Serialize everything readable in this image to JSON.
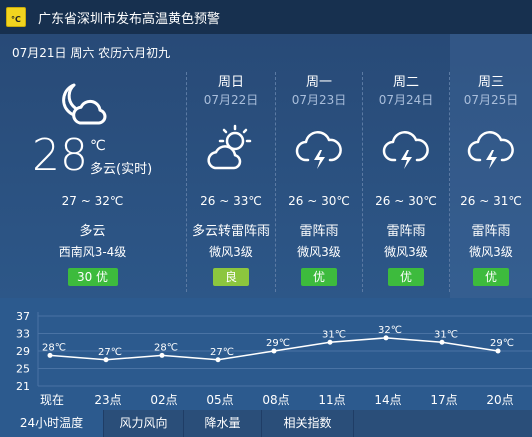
{
  "alert": {
    "icon": "high-temperature-alert-icon",
    "icon_text": "°C",
    "text": "广东省深圳市发布高温黄色预警"
  },
  "today": {
    "label": "07月21日 周六 农历六月初九",
    "icon": "night-partly-cloudy-icon",
    "temp_now": "28",
    "unit": "℃",
    "cond_now": "多云(实时)",
    "range": "27 ~ 32℃",
    "cond": "多云",
    "wind": "西南风3-4级",
    "aqi": "30 优",
    "aqi_color": "#3dbb3d"
  },
  "forecast": [
    {
      "dow": "周日",
      "date": "07月22日",
      "icon": "partly-cloudy-sun-icon",
      "range": "26 ~ 33℃",
      "cond": "多云转雷阵雨",
      "wind": "微风3级",
      "aqi": "良",
      "aqi_color": "#8cc63e"
    },
    {
      "dow": "周一",
      "date": "07月23日",
      "icon": "thunderstorm-icon",
      "range": "26 ~ 30℃",
      "cond": "雷阵雨",
      "wind": "微风3级",
      "aqi": "优",
      "aqi_color": "#3dbb3d"
    },
    {
      "dow": "周二",
      "date": "07月24日",
      "icon": "thunderstorm-icon",
      "range": "26 ~ 30℃",
      "cond": "雷阵雨",
      "wind": "微风3级",
      "aqi": "优",
      "aqi_color": "#3dbb3d"
    },
    {
      "dow": "周三",
      "date": "07月25日",
      "icon": "thunderstorm-icon",
      "range": "26 ~ 31℃",
      "cond": "雷阵雨",
      "wind": "微风3级",
      "aqi": "优",
      "aqi_color": "#3dbb3d"
    }
  ],
  "chart_data": {
    "type": "line",
    "categories": [
      "现在",
      "23点",
      "02点",
      "05点",
      "08点",
      "11点",
      "14点",
      "17点",
      "20点"
    ],
    "values": [
      28,
      27,
      28,
      27,
      29,
      31,
      32,
      31,
      29
    ],
    "point_labels": [
      "28℃",
      "27℃",
      "28℃",
      "27℃",
      "29℃",
      "31℃",
      "32℃",
      "31℃",
      "29℃"
    ],
    "yticks": [
      37,
      33,
      29,
      25,
      21
    ],
    "ylim": [
      21,
      37
    ],
    "grid": true
  },
  "tabs": [
    {
      "label": "24小时温度",
      "active": true
    },
    {
      "label": "风力风向",
      "active": false
    },
    {
      "label": "降水量",
      "active": false
    },
    {
      "label": "相关指数",
      "active": false
    }
  ]
}
